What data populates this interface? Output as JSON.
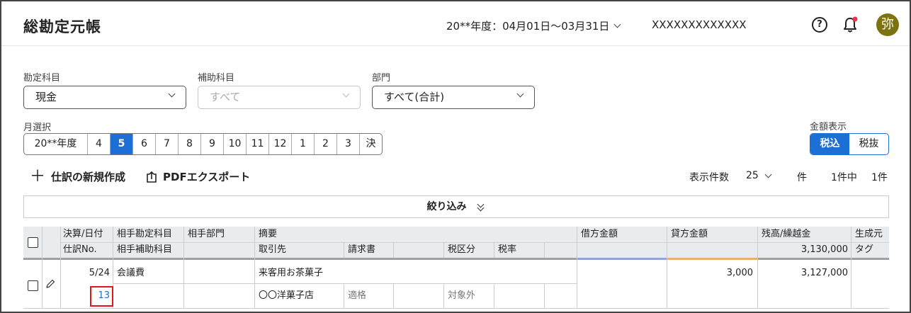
{
  "header": {
    "title": "総勘定元帳",
    "fiscal_period": "20**年度：04月01日〜03月31日",
    "company": "XXXXXXXXXXXXX",
    "help_glyph": "?",
    "avatar_text": "弥",
    "notification_dot_color": "#e8334a"
  },
  "filters": {
    "account": {
      "label": "勘定科目",
      "value": "現金"
    },
    "sub_account": {
      "label": "補助科目",
      "placeholder": "すべて"
    },
    "department": {
      "label": "部門",
      "value": "すべて(合計)"
    }
  },
  "months": {
    "label": "月選択",
    "items": [
      "20**年度",
      "4",
      "5",
      "6",
      "7",
      "8",
      "9",
      "10",
      "11",
      "12",
      "1",
      "2",
      "3",
      "決"
    ],
    "selected": "5"
  },
  "amount_display": {
    "label": "金額表示",
    "options": [
      "税込",
      "税抜"
    ],
    "selected": "税込"
  },
  "actions": {
    "new_entry": "仕訳の新規作成",
    "pdf_export": "PDFエクスポート"
  },
  "paging": {
    "per_page_label": "表示件数",
    "per_page_value": "25",
    "unit": "件",
    "summary": "1件中",
    "count": "1件"
  },
  "filter_bar": {
    "label": "絞り込み"
  },
  "table": {
    "headers_row1": [
      "決算/日付",
      "相手勘定科目",
      "相手部門",
      "摘要",
      "借方金額",
      "貸方金額",
      "残高/繰越金",
      "生成元"
    ],
    "headers_row2": [
      "仕訳No.",
      "相手補助科目",
      "取引先",
      "請求書",
      "税区分",
      "税率",
      "タグ"
    ],
    "carryover_balance": "3,130,000",
    "rows": [
      {
        "date": "5/24",
        "counter_account": "会議費",
        "description": "来客用お茶菓子",
        "debit": "",
        "credit": "3,000",
        "balance": "3,127,000",
        "entry_no": "13",
        "partner": "〇〇洋菓子店",
        "invoice": "適格",
        "tax_category": "対象外"
      }
    ],
    "colors": {
      "debit_bar": "#8fa4d8",
      "credit_bar": "#e8b06a",
      "balance_bar": "#a0a0a0"
    }
  }
}
